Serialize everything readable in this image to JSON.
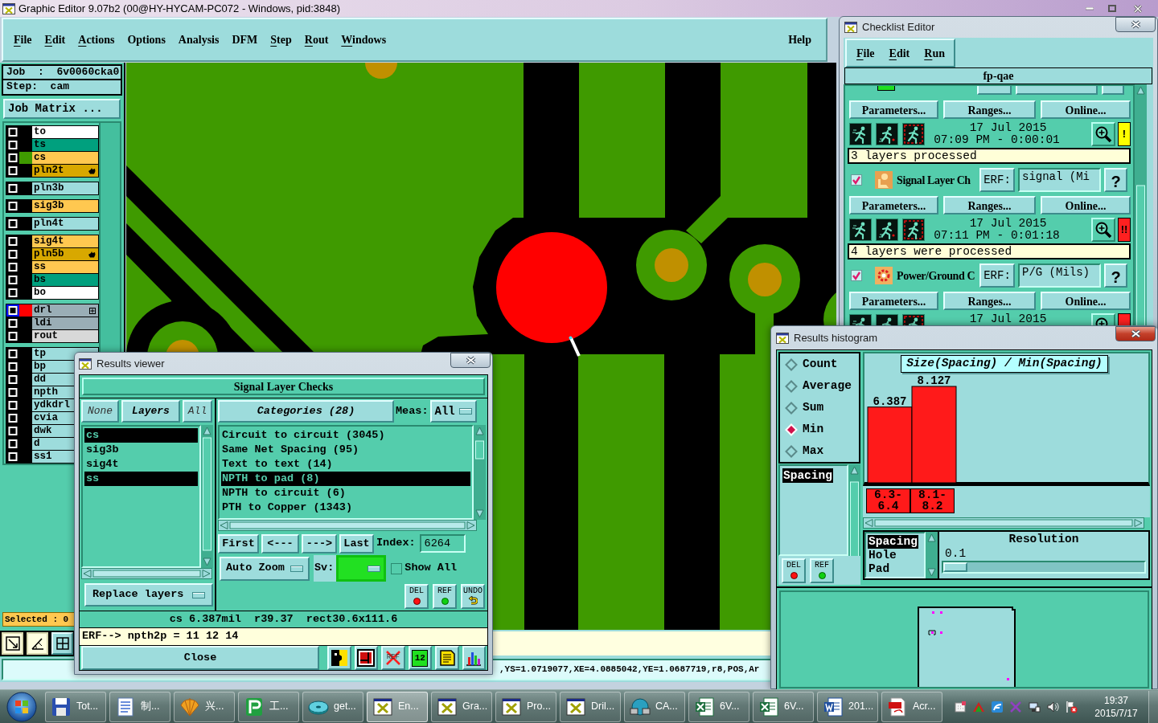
{
  "main_window": {
    "title": "Graphic Editor 9.07b2 (00@HY-HYCAM-PC072 - Windows, pid:3848)",
    "menu": [
      {
        "label": "File",
        "mnemonic": true
      },
      {
        "label": "Edit",
        "mnemonic": true
      },
      {
        "label": "Actions",
        "mnemonic": true
      },
      {
        "label": "Options",
        "mnemonic": false
      },
      {
        "label": "Analysis",
        "mnemonic": false
      },
      {
        "label": "DFM",
        "mnemonic": false
      },
      {
        "label": "Step",
        "mnemonic": true
      },
      {
        "label": "Rout",
        "mnemonic": true
      },
      {
        "label": "Windows",
        "mnemonic": true
      }
    ],
    "help_menu": {
      "label": "Help",
      "mnemonic": false
    },
    "job": "Job  :  6v0060cka0",
    "step": "Step:  cam",
    "job_matrix_button": "Job Matrix ...",
    "layer_groups": [
      [
        {
          "name": "to",
          "kind": "plain",
          "color": "#ffffff",
          "checked": false,
          "active": false
        },
        {
          "name": "ts",
          "kind": "plain",
          "color": "#00a07e",
          "checked": false,
          "active": false
        },
        {
          "name": "cs",
          "kind": "plain",
          "color": "#ffc850",
          "checked": false,
          "active": false,
          "swatch": {
            "color": "#3f9a00"
          }
        },
        {
          "name": "pln2t",
          "kind": "pointed",
          "color": "#d8a800",
          "checked": false,
          "active": false
        }
      ],
      [
        {
          "name": "pln3b",
          "kind": "plain",
          "color": "#9ddcdc",
          "checked": false,
          "active": false
        }
      ],
      [
        {
          "name": "sig3b",
          "kind": "plain",
          "color": "#ffc850",
          "checked": false,
          "active": false
        }
      ],
      [
        {
          "name": "pln4t",
          "kind": "plain",
          "color": "#9ddcdc",
          "checked": false,
          "active": false
        }
      ],
      [
        {
          "name": "sig4t",
          "kind": "plain",
          "color": "#ffc850",
          "checked": false,
          "active": false
        },
        {
          "name": "pln5b",
          "kind": "pointed",
          "color": "#d8a800",
          "checked": false,
          "active": false
        },
        {
          "name": "ss",
          "kind": "plain",
          "color": "#ffc850",
          "checked": false,
          "active": false
        },
        {
          "name": "bs",
          "kind": "plain",
          "color": "#00a07e",
          "checked": false,
          "active": false
        },
        {
          "name": "bo",
          "kind": "plain",
          "color": "#ffffff",
          "checked": false,
          "active": false
        }
      ],
      [
        {
          "name": "drl",
          "kind": "expandable",
          "color": "#9aaeb6",
          "checked": false,
          "active": true,
          "swatch": {
            "color": "#ff0000"
          }
        },
        {
          "name": "ldi",
          "kind": "plain",
          "color": "#9aaeb6",
          "checked": false,
          "active": false
        },
        {
          "name": "rout",
          "kind": "plain",
          "color": "#d8d8d8",
          "checked": false,
          "active": false
        }
      ],
      [
        {
          "name": "tp",
          "kind": "plain",
          "color": "#9ddcdc",
          "checked": false,
          "active": false
        },
        {
          "name": "bp",
          "kind": "plain",
          "color": "#9ddcdc",
          "checked": false,
          "active": false
        },
        {
          "name": "dd",
          "kind": "plain",
          "color": "#9ddcdc",
          "checked": false,
          "active": false
        },
        {
          "name": "npth",
          "kind": "plain",
          "color": "#9ddcdc",
          "checked": false,
          "active": false
        },
        {
          "name": "ydkdrl",
          "kind": "plain",
          "color": "#9ddcdc",
          "checked": false,
          "active": false
        },
        {
          "name": "cvia",
          "kind": "plain",
          "color": "#9ddcdc",
          "checked": false,
          "active": false
        },
        {
          "name": "dwk",
          "kind": "plain",
          "color": "#9ddcdc",
          "checked": false,
          "active": false
        },
        {
          "name": "d",
          "kind": "plain",
          "color": "#9ddcdc",
          "checked": false,
          "active": false
        },
        {
          "name": "ss1",
          "kind": "plain",
          "color": "#9ddcdc",
          "checked": false,
          "active": false
        }
      ]
    ],
    "selected_count": "Selected : 0",
    "coordinates": ",YS=1.0719077,XE=4.0885042,YE=1.0687719,r8,POS,Ar"
  },
  "results_viewer": {
    "title": "Results viewer",
    "header": "Signal Layer Checks",
    "layer_filter": {
      "none": "None",
      "title": "Layers",
      "all": "All"
    },
    "layers": [
      {
        "name": "cs",
        "selected": true
      },
      {
        "name": "sig3b",
        "selected": false
      },
      {
        "name": "sig4t",
        "selected": false
      },
      {
        "name": "ss",
        "selected": true
      }
    ],
    "categories_title": "Categories (28)",
    "meas_label": "Meas:",
    "meas_value": "All",
    "categories": [
      {
        "label": "Circuit to circuit (3045)",
        "selected": false
      },
      {
        "label": "Same Net Spacing (95)",
        "selected": false
      },
      {
        "label": "Text to text (14)",
        "selected": false
      },
      {
        "label": "NPTH to pad (8)",
        "selected": true
      },
      {
        "label": "NPTH to circuit (6)",
        "selected": false
      },
      {
        "label": "PTH to Copper (1343)",
        "selected": false
      }
    ],
    "nav_buttons": [
      "First",
      "<---",
      "--->",
      "Last"
    ],
    "index_label": "Index:",
    "index_value": "6264",
    "zoom_mode": "Auto Zoom",
    "sv_label": "Sv:",
    "show_all": {
      "label": "Show All",
      "checked": false
    },
    "layer_mode": "Replace layers",
    "actions": [
      {
        "label": "DEL",
        "kind": "del"
      },
      {
        "label": "REF",
        "kind": "ref"
      },
      {
        "label": "UNDO",
        "kind": "undo"
      }
    ],
    "measurement": "cs 6.387mil  r39.37  rect30.6x111.6",
    "erf_line": "ERF--> npth2p = 11 12 14",
    "close": "Close",
    "tools": [
      {
        "kind": "split"
      },
      {
        "kind": "marker"
      },
      {
        "kind": "no-ref",
        "label": "REF"
      },
      {
        "kind": "numbers",
        "label": "12"
      },
      {
        "kind": "report"
      },
      {
        "kind": "chart"
      }
    ]
  },
  "checklist_editor": {
    "title": "Checklist Editor",
    "menu": [
      {
        "label": "File",
        "mnemonic": true
      },
      {
        "label": "Edit",
        "mnemonic": true
      },
      {
        "label": "Run",
        "mnemonic": true
      }
    ],
    "checklist": "fp-qae",
    "rows": [
      {
        "kind": "buttons",
        "labels": [
          "Parameters...",
          "Ranges...",
          "Online..."
        ]
      },
      {
        "kind": "run",
        "date": "17 Jul 2015",
        "time": "07:09 PM - 0:00:01",
        "color": "#ffff00",
        "flag": "!"
      },
      {
        "kind": "message",
        "text": "3 layers processed"
      },
      {
        "kind": "check",
        "checked": true,
        "name": "Signal Layer Ch",
        "erf_label": "ERF:",
        "erf_value": "signal (Mi",
        "help": "?"
      },
      {
        "kind": "buttons",
        "labels": [
          "Parameters...",
          "Ranges...",
          "Online..."
        ]
      },
      {
        "kind": "run",
        "date": "17 Jul 2015",
        "time": "07:11 PM - 0:01:18",
        "color": "#ff2020",
        "flag": "!!"
      },
      {
        "kind": "message",
        "text": "4 layers were processed"
      },
      {
        "kind": "check",
        "checked": true,
        "name": "Power/Ground C",
        "erf_label": "ERF:",
        "erf_value": "P/G (Mils)",
        "help": "?"
      },
      {
        "kind": "buttons",
        "labels": [
          "Parameters...",
          "Ranges...",
          "Online..."
        ]
      },
      {
        "kind": "run",
        "date": "17 Jul 2015",
        "color": "#ff2020"
      }
    ]
  },
  "results_histogram": {
    "title": "Results histogram",
    "functions": [
      {
        "label": "Count",
        "selected": false
      },
      {
        "label": "Average",
        "selected": false
      },
      {
        "label": "Sum",
        "selected": false
      },
      {
        "label": "Min",
        "selected": true
      },
      {
        "label": "Max",
        "selected": false
      }
    ],
    "measures": [
      {
        "label": "Spacing",
        "selected": true
      }
    ],
    "actions": [
      {
        "label": "DEL",
        "kind": "del"
      },
      {
        "label": "REF",
        "kind": "ref"
      }
    ],
    "chart_data": {
      "type": "bar",
      "title": "Size(Spacing) / Min(Spacing)",
      "categories": [
        "6.3-6.4",
        "8.1-8.2"
      ],
      "values": [
        6.387,
        8.127
      ],
      "data_labels": true
    },
    "attributes": [
      {
        "label": "Spacing",
        "selected": true
      },
      {
        "label": "Hole",
        "selected": false
      },
      {
        "label": "Pad",
        "selected": false
      }
    ],
    "resolution_label": "Resolution",
    "resolution_value": "0.1",
    "resolution_slider": {
      "level": 0
    }
  },
  "taskbar": {
    "items": [
      {
        "label": "Tot...",
        "selected": false
      },
      {
        "label": "制...",
        "selected": false
      },
      {
        "label": "兴...",
        "selected": false
      },
      {
        "label": "工...",
        "selected": false
      },
      {
        "label": "get...",
        "selected": false
      },
      {
        "label": "En...",
        "selected": true
      },
      {
        "label": "Gra...",
        "selected": false
      },
      {
        "label": "Pro...",
        "selected": false
      },
      {
        "label": "Dril...",
        "selected": false
      },
      {
        "label": "CA...",
        "selected": false
      },
      {
        "label": "6V...",
        "selected": false
      },
      {
        "label": "6V...",
        "selected": false
      },
      {
        "label": "201...",
        "selected": false
      },
      {
        "label": "Acr...",
        "selected": false
      }
    ],
    "time": "19:37",
    "date": "2015/7/17"
  }
}
